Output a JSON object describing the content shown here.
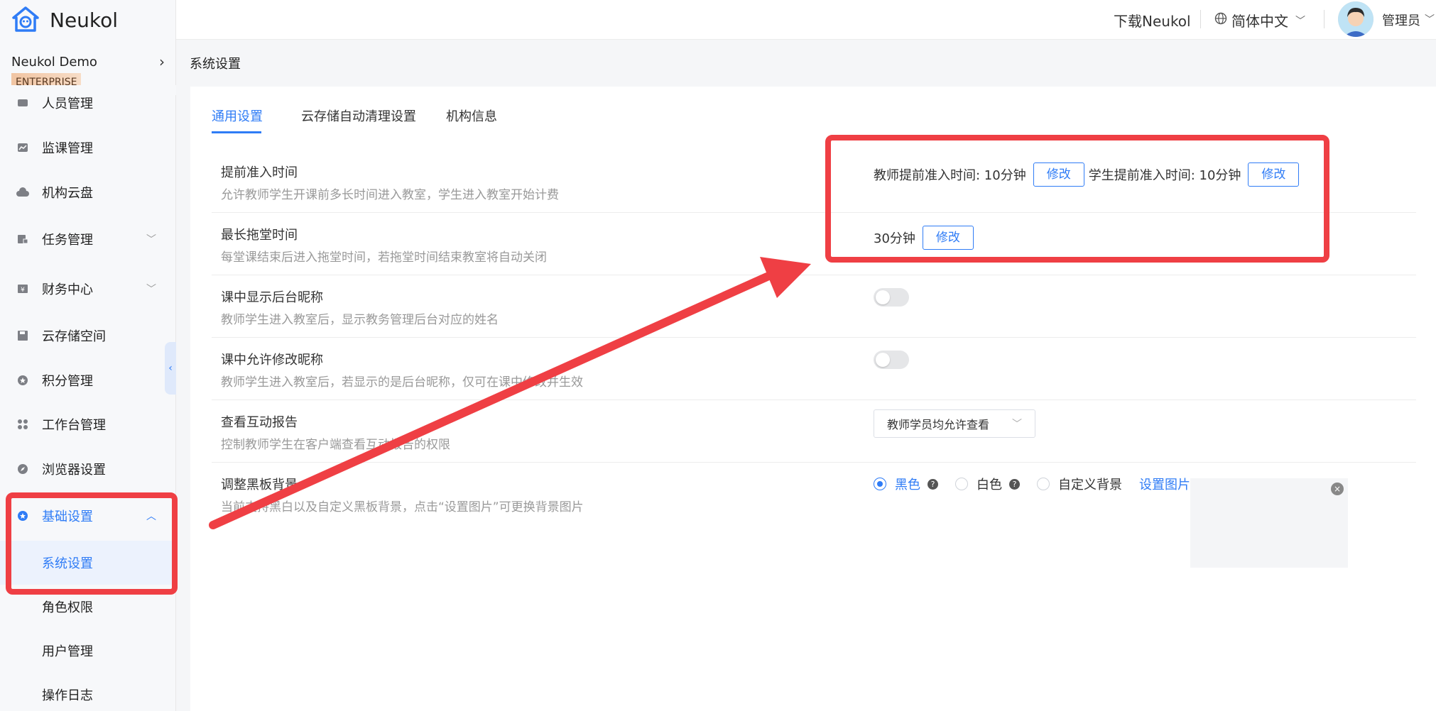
{
  "app": {
    "name": "Neukol"
  },
  "org": {
    "name": "Neukol Demo",
    "edition": "ENTERPRISE"
  },
  "header": {
    "download": "下载Neukol",
    "language": "简体中文",
    "user": "管理员"
  },
  "sidebar": {
    "items": [
      {
        "label": "人员管理",
        "icon": "users-icon"
      },
      {
        "label": "监课管理",
        "icon": "chart-icon"
      },
      {
        "label": "机构云盘",
        "icon": "cloud-icon"
      },
      {
        "label": "任务管理",
        "icon": "task-icon"
      },
      {
        "label": "财务中心",
        "icon": "finance-icon"
      },
      {
        "label": "云存储空间",
        "icon": "save-icon"
      },
      {
        "label": "积分管理",
        "icon": "points-icon"
      },
      {
        "label": "工作台管理",
        "icon": "grid-icon"
      },
      {
        "label": "浏览器设置",
        "icon": "compass-icon"
      },
      {
        "label": "基础设置",
        "icon": "settings-icon"
      }
    ],
    "sub_items": [
      "系统设置",
      "角色权限",
      "用户管理",
      "操作日志"
    ]
  },
  "page": {
    "title": "系统设置"
  },
  "tabs": [
    "通用设置",
    "云存储自动清理设置",
    "机构信息"
  ],
  "settings": {
    "early_entry": {
      "title": "提前准入时间",
      "desc": "允许教师学生开课前多长时间进入教室，学生进入教室开始计费",
      "teacher_text": "教师提前准入时间: 10分钟",
      "student_text": "学生提前准入时间: 10分钟",
      "edit": "修改"
    },
    "max_overtime": {
      "title": "最长拖堂时间",
      "desc": "每堂课结束后进入拖堂时间，若拖堂时间结束教室将自动关闭",
      "value": "30分钟",
      "edit": "修改"
    },
    "show_nickname": {
      "title": "课中显示后台昵称",
      "desc": "教师学生进入教室后，显示教务管理后台对应的姓名",
      "enabled": false
    },
    "allow_rename": {
      "title": "课中允许修改昵称",
      "desc": "教师学生进入教室后，若显示的是后台昵称，仅可在课中修改并生效",
      "enabled": false
    },
    "report": {
      "title": "查看互动报告",
      "desc": "控制教师学生在客户端查看互动报告的权限",
      "selected": "教师学员均允许查看"
    },
    "board_bg": {
      "title": "调整黑板背景",
      "desc": "当前支持黑白以及自定义黑板背景，点击“设置图片”可更换背景图片",
      "options": [
        "黑色",
        "白色",
        "自定义背景"
      ],
      "selected": "黑色",
      "set_image": "设置图片"
    }
  },
  "colors": {
    "primary": "#2f7cf6",
    "annotation": "#ef3f44"
  }
}
